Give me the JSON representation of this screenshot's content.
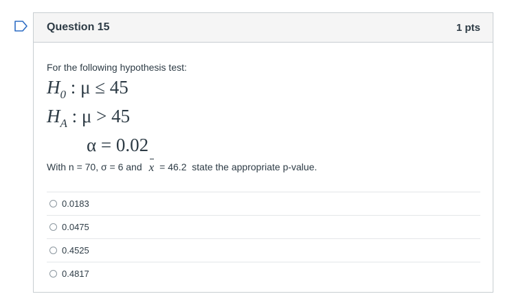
{
  "question": {
    "title": "Question 15",
    "points": "1 pts",
    "intro": "For the following hypothesis test:",
    "null_lhs": "H",
    "null_sub": "0",
    "null_rhs": " : μ ≤ 45",
    "alt_lhs": "H",
    "alt_sub": "A",
    "alt_rhs": " : μ > 45",
    "alpha": "α = 0.02",
    "given_prefix": "With n = 70, σ = 6 and",
    "given_xbar": "x",
    "given_suffix": "= 46.2  state the appropriate p-value."
  },
  "answers": [
    {
      "label": "0.0183"
    },
    {
      "label": "0.0475"
    },
    {
      "label": "0.4525"
    },
    {
      "label": "0.4817"
    }
  ],
  "colors": {
    "flag_outline": "#2b6cc4",
    "header_bg": "#f5f5f5",
    "border": "#c7cdd1",
    "text": "#2d3b45"
  }
}
